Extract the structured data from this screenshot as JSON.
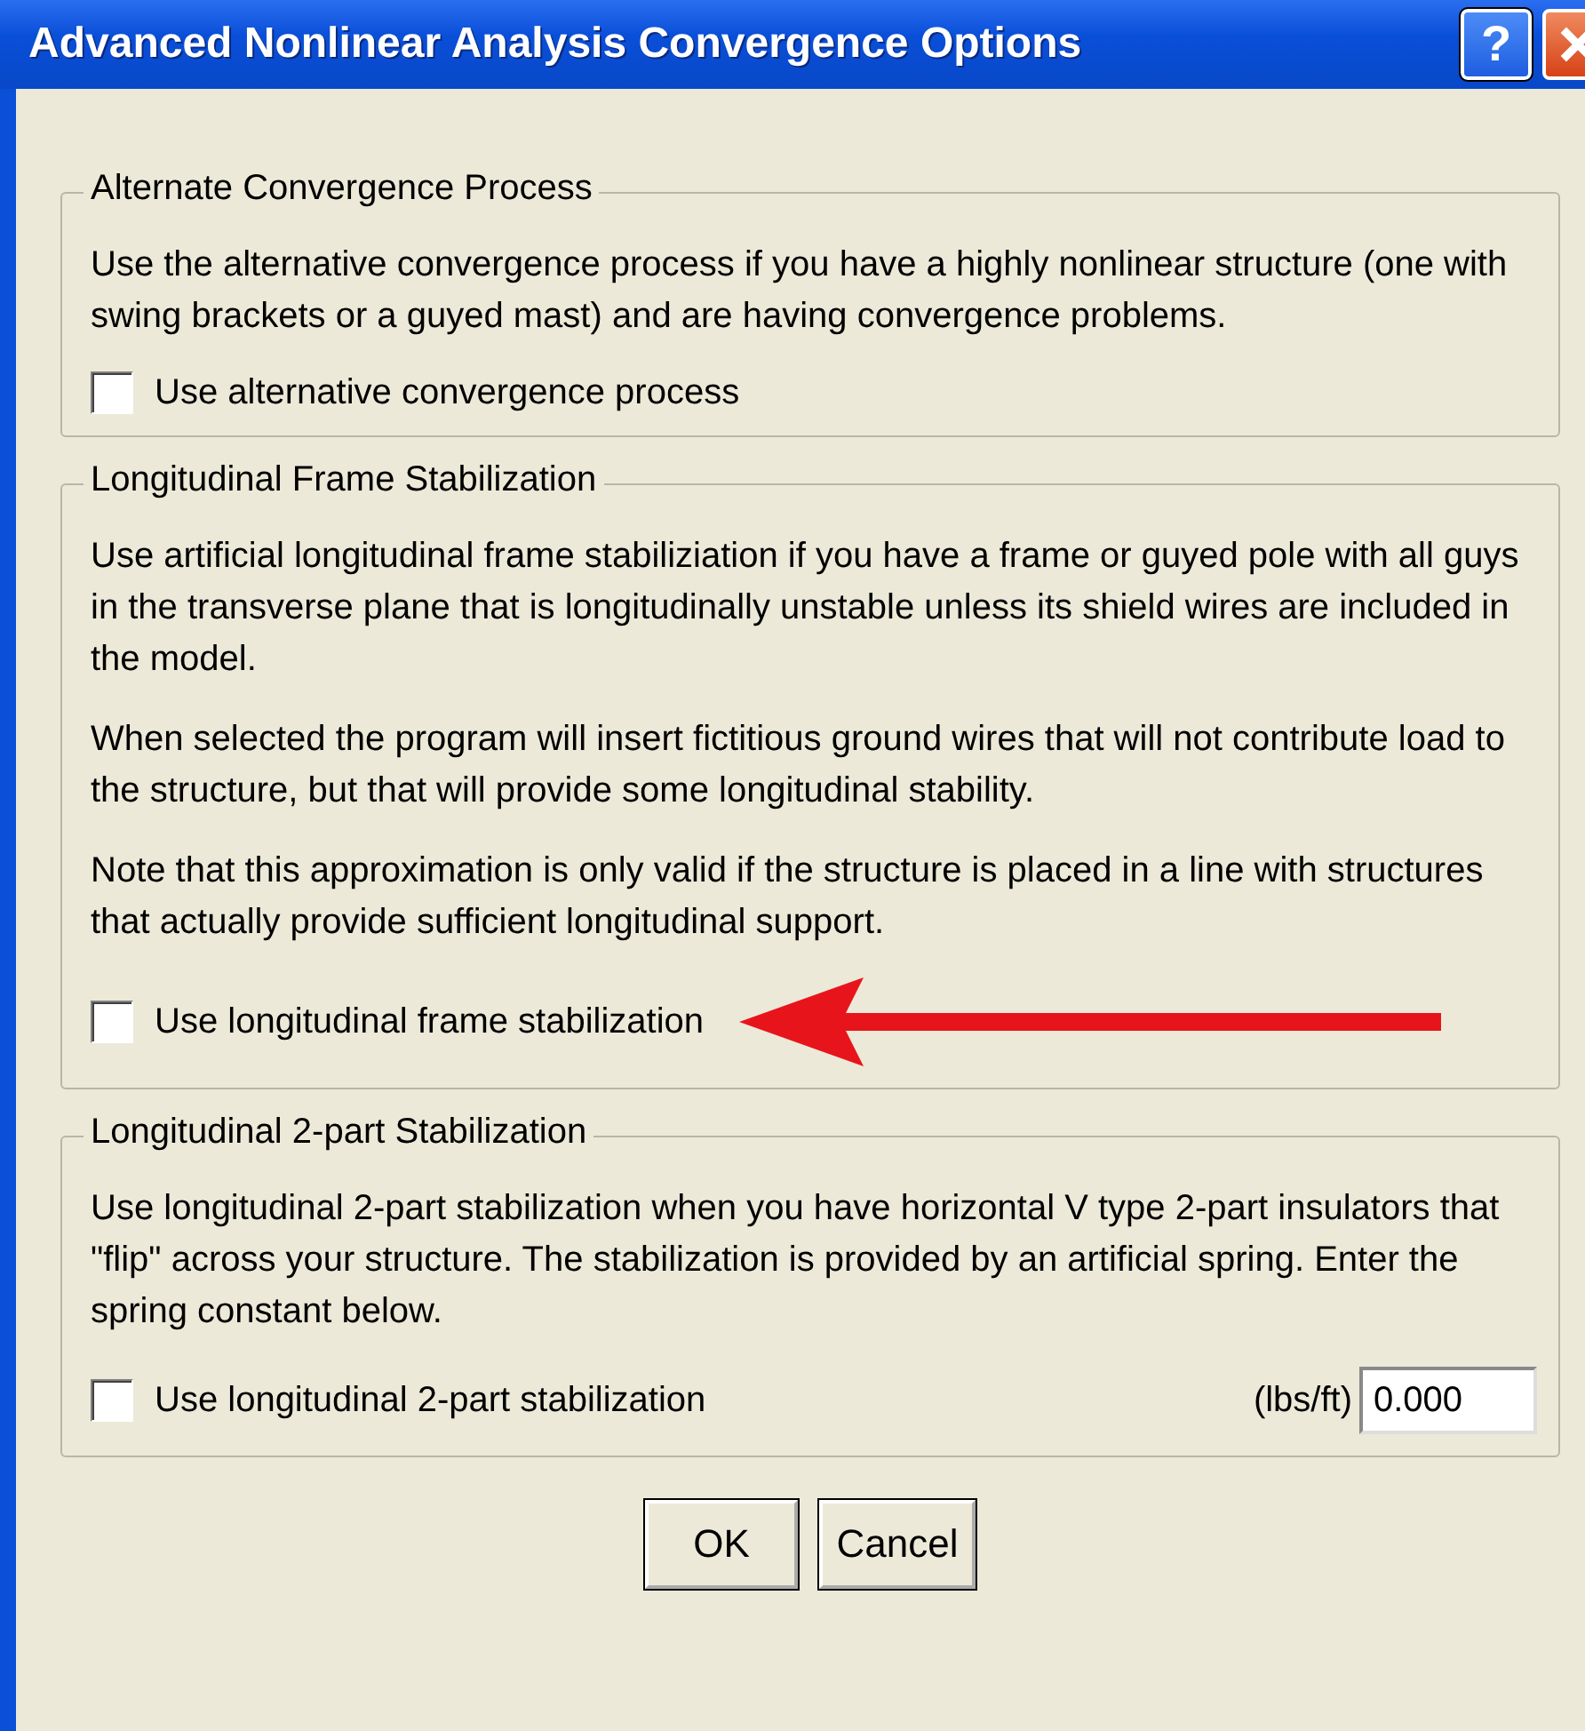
{
  "window": {
    "title": "Advanced Nonlinear Analysis Convergence Options",
    "help_button": "?"
  },
  "groups": [
    {
      "legend": "Alternate Convergence Process",
      "paragraphs": [
        "Use the alternative convergence process if you have a highly nonlinear structure (one with swing brackets or a guyed mast) and are having convergence problems."
      ],
      "checkbox": {
        "label": "Use alternative convergence process",
        "checked": false
      }
    },
    {
      "legend": "Longitudinal Frame Stabilization",
      "paragraphs": [
        "Use artificial longitudinal frame stabiliziation if you have a frame or guyed pole with all guys in the transverse plane that is longitudinally unstable unless its shield wires are included in the model.",
        "When selected the program will insert fictitious ground wires that will not contribute load to the structure, but that will provide some longitudinal stability.",
        "Note that this approximation is only valid if the structure is placed in a line with structures that actually provide sufficient longitudinal support."
      ],
      "checkbox": {
        "label": "Use longitudinal frame stabilization",
        "checked": false
      },
      "annotation_arrow": true
    },
    {
      "legend": "Longitudinal 2-part Stabilization",
      "paragraphs": [
        "Use longitudinal 2-part stabilization when you have horizontal V type 2-part insulators that \"flip\" across your structure.  The stabilization is provided by an artificial spring.  Enter the spring constant below."
      ],
      "checkbox": {
        "label": "Use longitudinal 2-part stabilization",
        "checked": false
      },
      "field": {
        "unit": "(lbs/ft)",
        "value": "0.000"
      }
    }
  ],
  "buttons": [
    "OK",
    "Cancel"
  ]
}
